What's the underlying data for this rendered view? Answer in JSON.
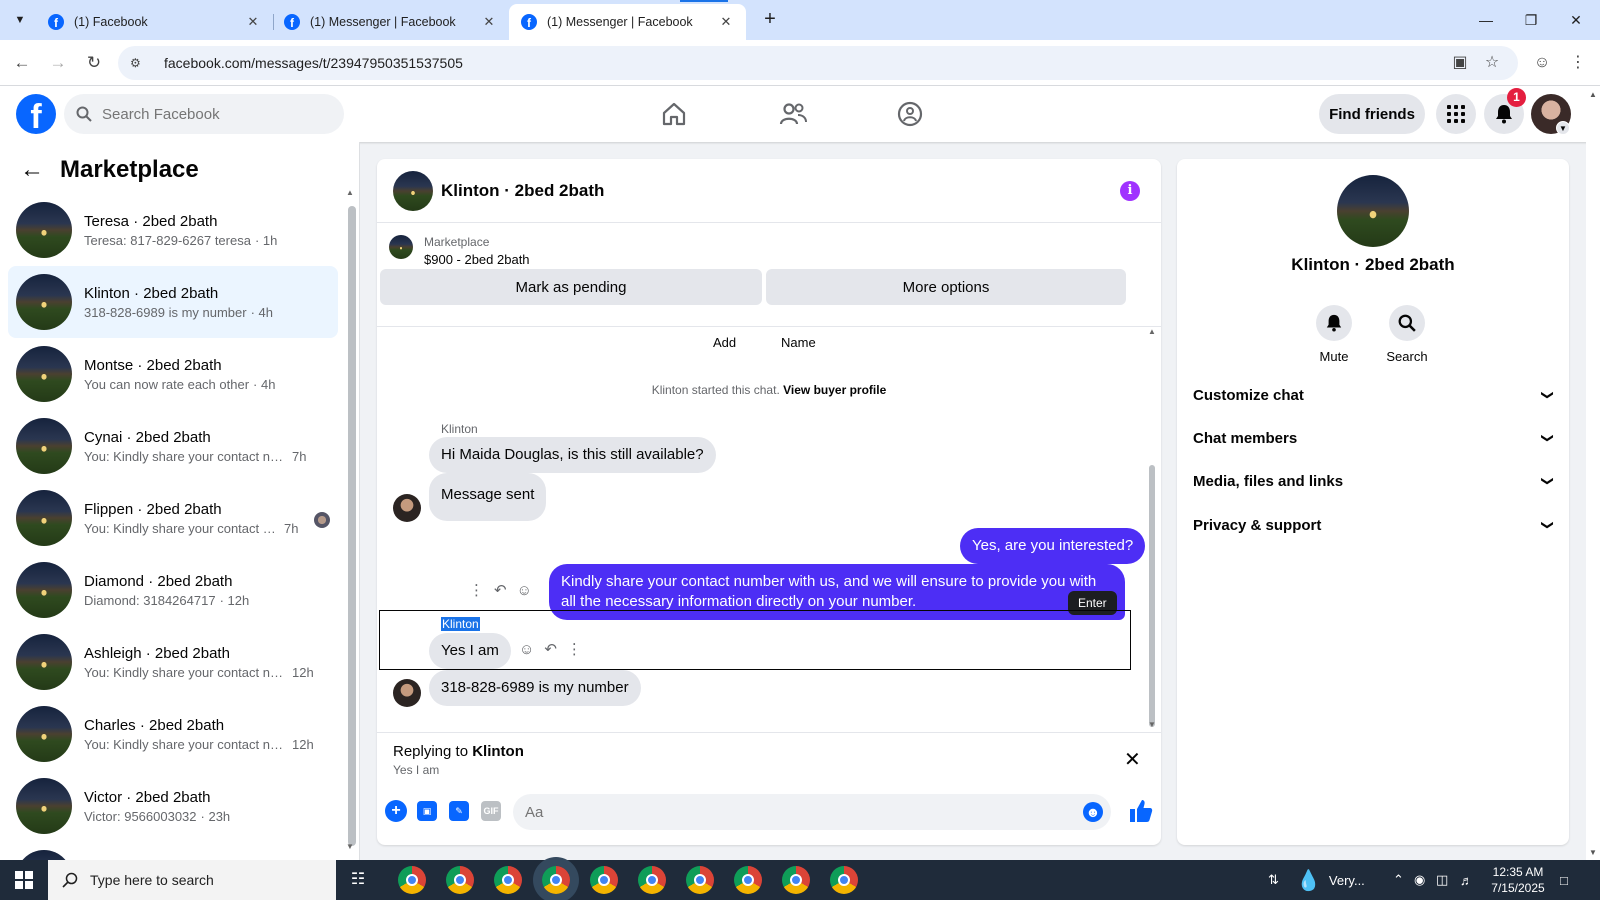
{
  "browser": {
    "tabs": [
      {
        "title": "(1) Facebook",
        "active": false
      },
      {
        "title": "(1) Messenger | Facebook",
        "active": false
      },
      {
        "title": "(1) Messenger | Facebook",
        "active": true
      }
    ],
    "url": "facebook.com/messages/t/23947950351537505"
  },
  "header": {
    "search_placeholder": "Search Facebook",
    "find_friends": "Find friends",
    "notification_count": "1"
  },
  "sidebar": {
    "title": "Marketplace",
    "conversations": [
      {
        "name": "Teresa · 2bed 2bath",
        "snippet": "Teresa: 817-829-6267 teresa",
        "time": "· 1h",
        "selected": false
      },
      {
        "name": "Klinton · 2bed 2bath",
        "snippet": "318-828-6989 is my number",
        "time": "· 4h",
        "selected": true
      },
      {
        "name": "Montse · 2bed 2bath",
        "snippet": "You can now rate each other",
        "time": "· 4h",
        "selected": false
      },
      {
        "name": "Cynai · 2bed 2bath",
        "snippet": "You: Kindly share your contact num...",
        "time": "7h",
        "selected": false
      },
      {
        "name": "Flippen · 2bed 2bath",
        "snippet": "You: Kindly share your contact n...",
        "time": "7h",
        "selected": false
      },
      {
        "name": "Diamond · 2bed 2bath",
        "snippet": "Diamond: 3184264717",
        "time": "· 12h",
        "selected": false
      },
      {
        "name": "Ashleigh · 2bed 2bath",
        "snippet": "You: Kindly share your contact nu...",
        "time": "12h",
        "selected": false
      },
      {
        "name": "Charles · 2bed 2bath",
        "snippet": "You: Kindly share your contact nu...",
        "time": "12h",
        "selected": false
      },
      {
        "name": "Victor · 2bed 2bath",
        "snippet": "Victor: 9566003032",
        "time": "· 23h",
        "selected": false
      }
    ]
  },
  "chat": {
    "title": "Klinton · 2bed 2bath",
    "marketplace_label": "Marketplace",
    "listing": "$900 - 2bed 2bath",
    "mark_pending": "Mark as pending",
    "more_options": "More options",
    "context_add": "Add",
    "context_name": "Name",
    "system_note": "Klinton started this chat.",
    "system_link": "View buyer profile",
    "sender_name": "Klinton",
    "msg_1": "Hi Maida Douglas, is this still available?",
    "msg_2": "Message sent",
    "msg_3": "Yes, are you interested?",
    "msg_4": "Kindly share your contact number with us, and we will ensure to provide you with all the necessary information directly on your number.",
    "tooltip": "Enter",
    "msg_5": "Yes I am",
    "msg_6": "318-828-6989 is my number",
    "replying_prefix": "Replying to ",
    "replying_name": "Klinton",
    "replying_quote": "Yes I am",
    "composer_placeholder": "Aa"
  },
  "info_panel": {
    "name": "Klinton · 2bed 2bath",
    "mute": "Mute",
    "search": "Search",
    "sections": [
      "Customize chat",
      "Chat members",
      "Media, files and links",
      "Privacy & support"
    ]
  },
  "taskbar": {
    "search_placeholder": "Type here to search",
    "weather": "Very...",
    "time": "12:35 AM",
    "date": "7/15/2025"
  },
  "colors": {
    "brand": "#0866ff",
    "outgoing_bubble": "#4d2ef5",
    "selected_conversation": "#ebf5ff",
    "info_button": "#a033ff",
    "badge": "#e41e3f"
  }
}
